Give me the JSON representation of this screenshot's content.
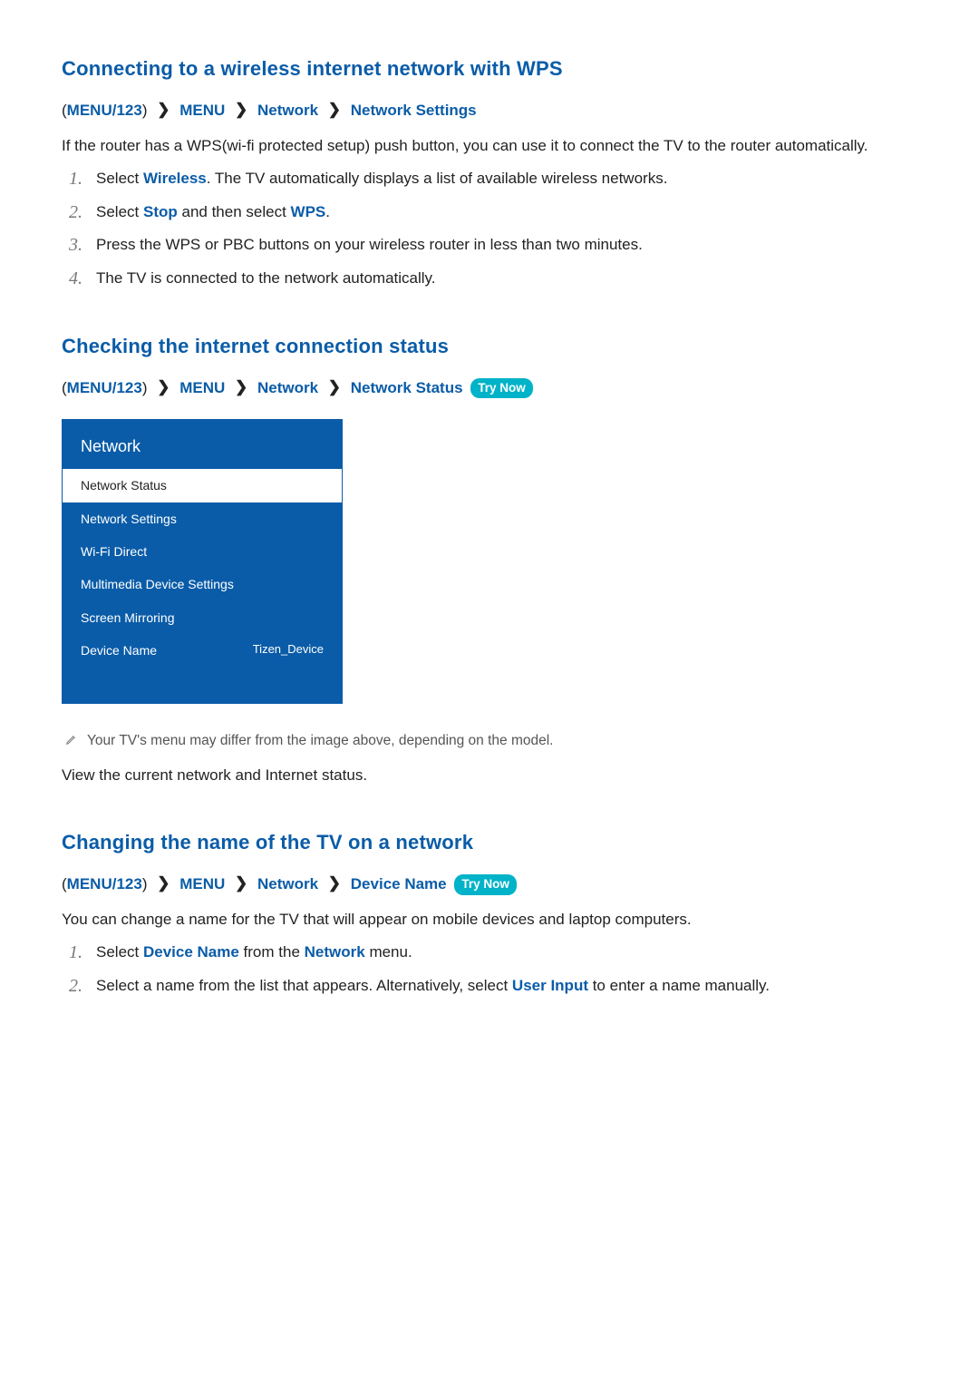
{
  "section1": {
    "title": "Connecting to a wireless internet network with WPS",
    "breadcrumb": {
      "menu123": "MENU/123",
      "menu": "MENU",
      "network": "Network",
      "leaf": "Network Settings"
    },
    "intro": "If the router has a WPS(wi-fi protected setup) push button, you can use it to connect the TV to the router automatically.",
    "steps": {
      "s1_a": "Select ",
      "s1_hl": "Wireless",
      "s1_b": ". The TV automatically displays a list of available wireless networks.",
      "s2_a": "Select ",
      "s2_hl1": "Stop",
      "s2_b": " and then select ",
      "s2_hl2": "WPS",
      "s2_c": ".",
      "s3": "Press the WPS or PBC buttons on your wireless router in less than two minutes.",
      "s4": "The TV is connected to the network automatically."
    }
  },
  "section2": {
    "title": "Checking the internet connection status",
    "breadcrumb": {
      "menu123": "MENU/123",
      "menu": "MENU",
      "network": "Network",
      "leaf": "Network Status"
    },
    "try_now": "Try Now",
    "menu_box": {
      "title": "Network",
      "items": [
        {
          "label": "Network Status",
          "selected": true
        },
        {
          "label": "Network Settings"
        },
        {
          "label": "Wi-Fi Direct"
        },
        {
          "label": "Multimedia Device Settings"
        },
        {
          "label": "Screen Mirroring"
        },
        {
          "label": "Device Name",
          "value": "Tizen_Device"
        }
      ]
    },
    "note": "Your TV's menu may differ from the image above, depending on the model.",
    "body": "View the current network and Internet status."
  },
  "section3": {
    "title": "Changing the name of the TV on a network",
    "breadcrumb": {
      "menu123": "MENU/123",
      "menu": "MENU",
      "network": "Network",
      "leaf": "Device Name"
    },
    "try_now": "Try Now",
    "intro": "You can change a name for the TV that will appear on mobile devices and laptop computers.",
    "steps": {
      "s1_a": "Select ",
      "s1_hl1": "Device Name",
      "s1_b": " from the ",
      "s1_hl2": "Network",
      "s1_c": " menu.",
      "s2_a": "Select a name from the list that appears. Alternatively, select ",
      "s2_hl": "User Input",
      "s2_b": " to enter a name manually."
    }
  },
  "glyphs": {
    "chev": "❯"
  }
}
